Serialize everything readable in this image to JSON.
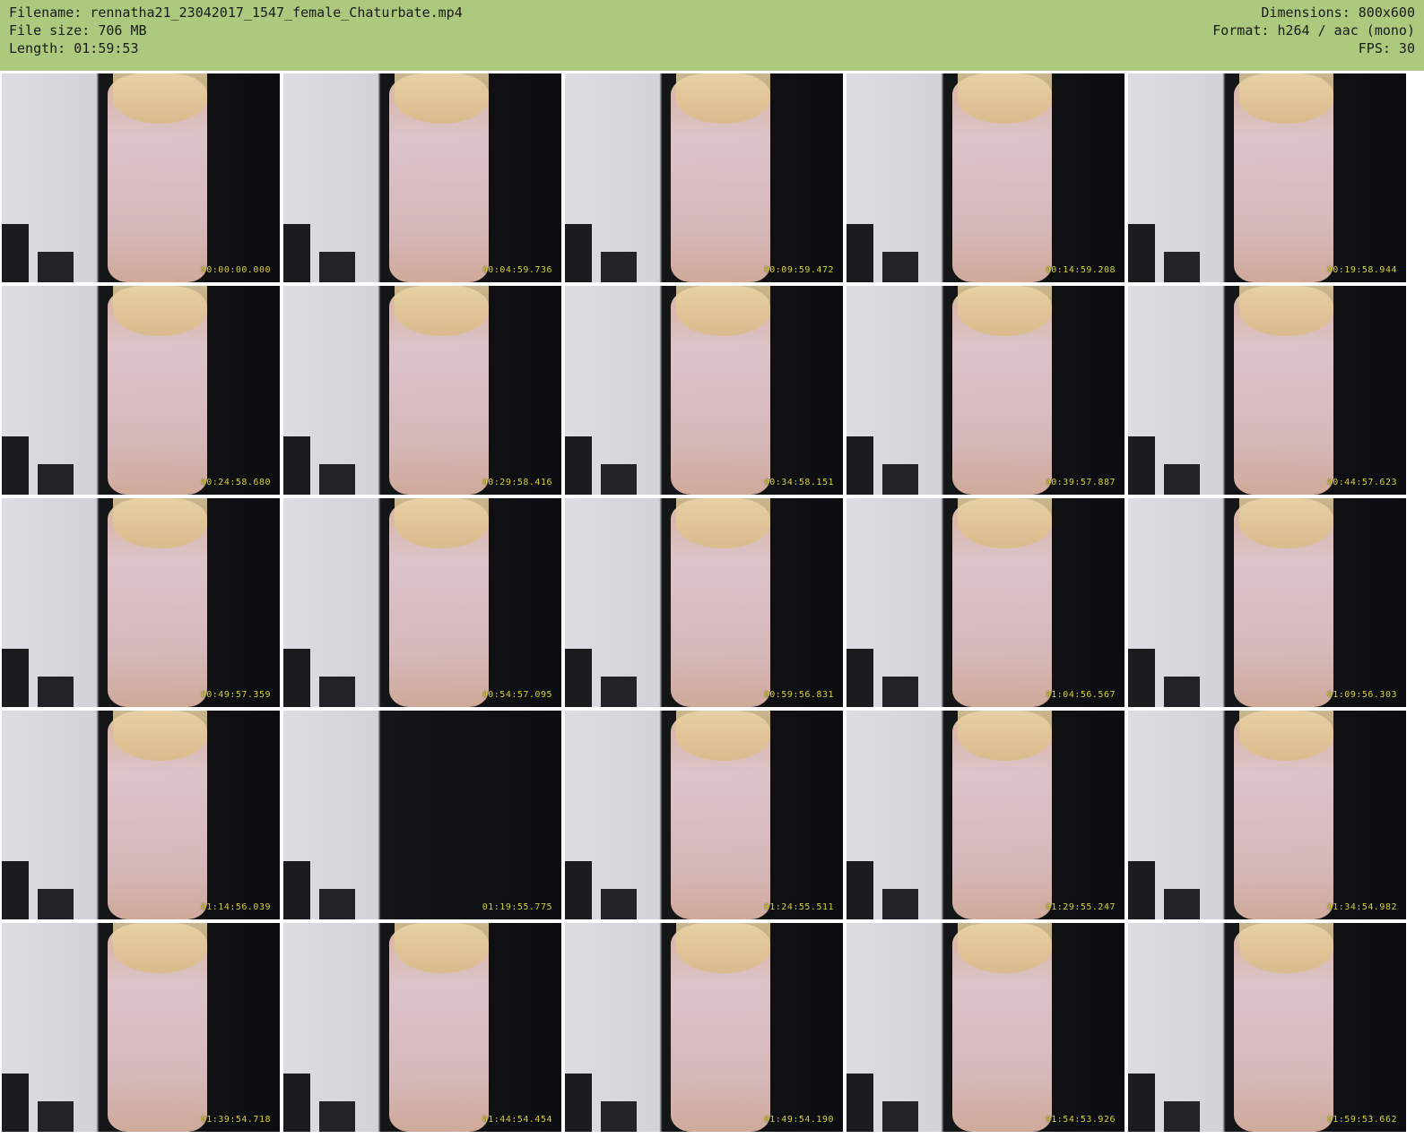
{
  "header": {
    "filename": "Filename: rennatha21_23042017_1547_female_Chaturbate.mp4",
    "filesize": "File size: 706 MB",
    "length": "Length: 01:59:53",
    "dimensions": "Dimensions: 800x600",
    "format": "Format: h264 / aac (mono)",
    "fps": "FPS: 30"
  },
  "thumbnails": [
    {
      "timestamp": "00:00:00.000"
    },
    {
      "timestamp": "00:04:59.736"
    },
    {
      "timestamp": "00:09:59.472"
    },
    {
      "timestamp": "00:14:59.208"
    },
    {
      "timestamp": "00:19:58.944"
    },
    {
      "timestamp": "00:24:58.680"
    },
    {
      "timestamp": "00:29:58.416"
    },
    {
      "timestamp": "00:34:58.151"
    },
    {
      "timestamp": "00:39:57.887"
    },
    {
      "timestamp": "00:44:57.623"
    },
    {
      "timestamp": "00:49:57.359"
    },
    {
      "timestamp": "00:54:57.095"
    },
    {
      "timestamp": "00:59:56.831"
    },
    {
      "timestamp": "01:04:56.567"
    },
    {
      "timestamp": "01:09:56.303"
    },
    {
      "timestamp": "01:14:56.039"
    },
    {
      "timestamp": "01:19:55.775"
    },
    {
      "timestamp": "01:24:55.511"
    },
    {
      "timestamp": "01:29:55.247"
    },
    {
      "timestamp": "01:34:54.982"
    },
    {
      "timestamp": "01:39:54.718"
    },
    {
      "timestamp": "01:44:54.454"
    },
    {
      "timestamp": "01:49:54.190"
    },
    {
      "timestamp": "01:54:53.926"
    },
    {
      "timestamp": "01:59:53.662"
    }
  ]
}
